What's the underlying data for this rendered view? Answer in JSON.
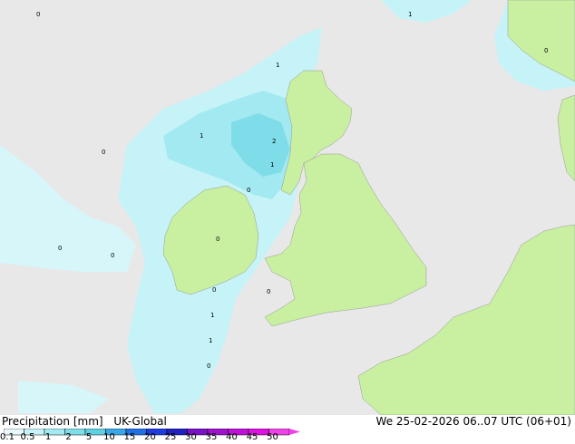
{
  "map": {
    "colors": {
      "sea": "#e8e8e8",
      "land": "#c8f0a0",
      "light_precip": "#c6f3f7",
      "med_precip": "#a2e9f2",
      "heavy_precip": "#7fdde9"
    },
    "point_labels": [
      "0",
      "1",
      "2",
      "0",
      "1",
      "0",
      "1",
      "0",
      "0",
      "0",
      "0",
      "1",
      "1",
      "0",
      "0",
      "1",
      "0"
    ]
  },
  "legend": {
    "title": "Precipitation [mm]",
    "model": "UK-Global",
    "datetime": "We 25-02-2026 06..07 UTC (06+01)",
    "scale": [
      "0.1",
      "0.5",
      "1",
      "2",
      "5",
      "10",
      "15",
      "20",
      "25",
      "30",
      "35",
      "40",
      "45",
      "50"
    ],
    "colors": [
      "#e8f8fc",
      "#c6f3f7",
      "#a2e9f2",
      "#7fdde9",
      "#5fcfe2",
      "#3aa8e6",
      "#2270e6",
      "#1f3ce0",
      "#2020c0",
      "#7a10c8",
      "#a010d0",
      "#c010d8",
      "#e010e0",
      "#f040e8"
    ]
  }
}
